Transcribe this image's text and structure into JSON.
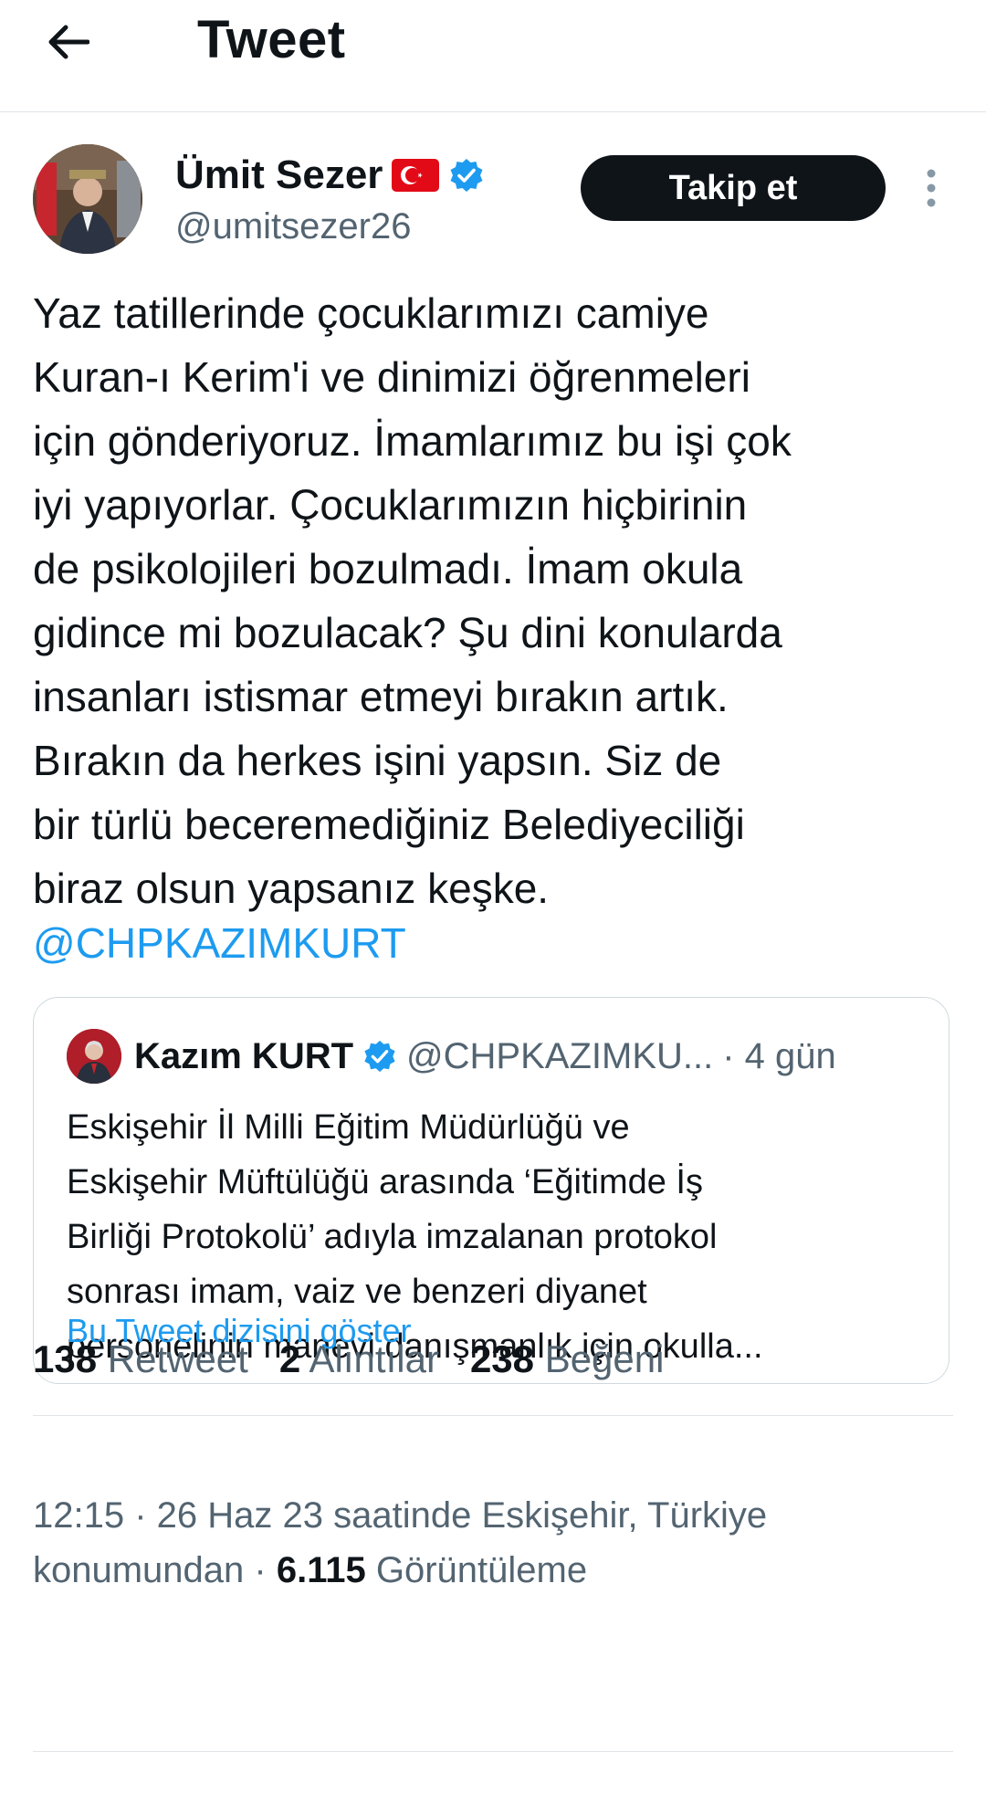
{
  "header": {
    "title": "Tweet",
    "back_icon": "arrow-left-icon"
  },
  "tweet": {
    "author": {
      "name": "Ümit Sezer",
      "handle": "@umitsezer26",
      "flag_icon": "turkey-flag-icon",
      "verified_icon": "verified-badge-icon"
    },
    "follow_label": "Takip et",
    "more_icon": "more-vertical-icon",
    "text": "Yaz tatillerinde çocuklarımızı camiye\nKuran-ı Kerim'i ve dinimizi öğrenmeleri\niçin gönderiyoruz. İmamlarımız bu işi çok\niyi yapıyorlar. Çocuklarımızın hiçbirinin\nde psikolojileri bozulmadı. İmam okula\ngidince mi bozulacak? Şu dini konularda\ninsanları istismar etmeyi bırakın artık.\nBırakın da herkes işini yapsın. Siz de\nbir türlü beceremediğiniz Belediyeciliği\nbiraz olsun yapsanız keşke.",
    "mention": "@CHPKAZIMKURT",
    "quote": {
      "name": "Kazım KURT",
      "handle": "@CHPKAZIMKU...",
      "time": "· 4 gün",
      "text": "Eskişehir İl Milli Eğitim Müdürlüğü ve\nEskişehir Müftülüğü arasında ‘Eğitimde İş\nBirliği Protokolü’ adıyla imzalanan protokol\nsonrası imam, vaiz ve benzeri diyanet\npersonelinin manevi danışmanlık için okulla...",
      "thread_link": "Bu Tweet dizisini göster"
    },
    "meta": {
      "line1": "12:15 · 26 Haz 23 saatinde Eskişehir, Türkiye",
      "line2_prefix": "konumundan · ",
      "views_count": "6.115",
      "views_label": " Görüntüleme"
    },
    "stats": [
      {
        "count": "138",
        "label": "Retweet"
      },
      {
        "count": "2",
        "label": "Alıntılar"
      },
      {
        "count": "238",
        "label": "Beğeni"
      }
    ]
  },
  "colors": {
    "accent": "#1d9bf0",
    "text_primary": "#0f1419",
    "text_secondary": "#536471",
    "border": "#cfd9de",
    "follow_button_bg": "#0f1419"
  }
}
